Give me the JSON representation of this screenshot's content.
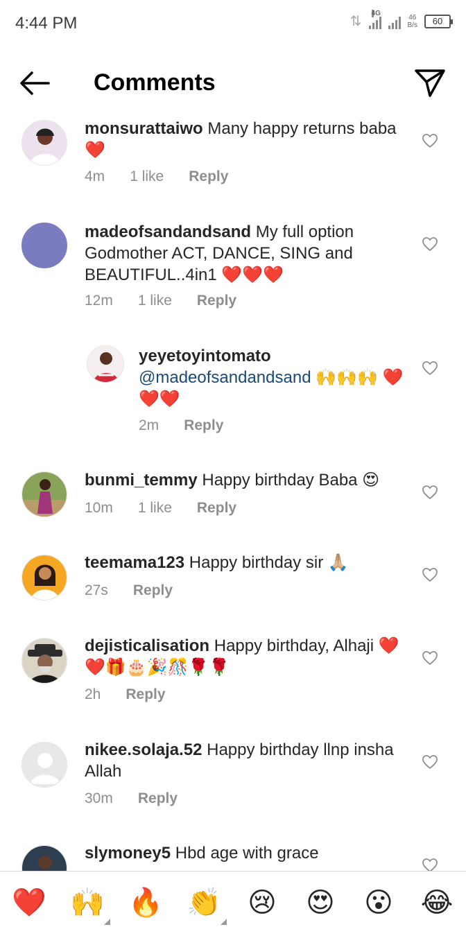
{
  "status": {
    "time": "4:44 PM",
    "network": "4G",
    "speed_top": "46",
    "speed_bottom": "B/s",
    "battery": "60"
  },
  "header": {
    "title": "Comments",
    "back_icon": "arrow-left-icon",
    "send_icon": "paper-plane-icon"
  },
  "comments": [
    {
      "username": "monsurattaiwo",
      "text": " Many happy returns baba❤️",
      "time": "4m",
      "likes": "1 like",
      "reply": "Reply"
    },
    {
      "username": "madeofsandandsand",
      "text": " My full option Godmother ACT, DANCE, SING and BEAUTIFUL..4in1 ❤️❤️❤️",
      "time": "12m",
      "likes": "1 like",
      "reply": "Reply"
    },
    {
      "username": "yeyetoyintomato",
      "mention": "@madeofsandandsand",
      "text": " 🙌🙌🙌 ❤️❤️❤️",
      "time": "2m",
      "reply": "Reply"
    },
    {
      "username": "bunmi_temmy",
      "text": " Happy birthday Baba 😍",
      "time": "10m",
      "likes": "1 like",
      "reply": "Reply"
    },
    {
      "username": "teemama123",
      "text": " Happy birthday sir 🙏🏼",
      "time": "27s",
      "reply": "Reply"
    },
    {
      "username": "dejisticalisation",
      "text": " Happy birthday, Alhaji ❤️❤️🎁🎂🎉🎊🌹🌹",
      "time": "2h",
      "reply": "Reply"
    },
    {
      "username": "nikee.solaja.52",
      "text": " Happy birthday llnp insha Allah",
      "time": "30m",
      "reply": "Reply"
    },
    {
      "username": "slymoney5",
      "text": " Hbd age with grace"
    }
  ],
  "emoji_bar": [
    "❤️",
    "🙌",
    "🔥",
    "👏",
    "😢",
    "😍",
    "😮",
    "😂"
  ],
  "colors": {
    "text": "#262626",
    "meta": "#8e8e8e",
    "mention": "#1a4a7a",
    "avatar_purple": "#7b7bbf"
  }
}
